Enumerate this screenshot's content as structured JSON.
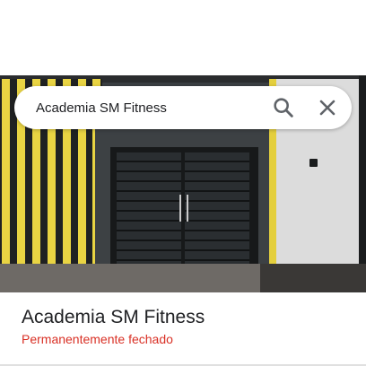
{
  "search": {
    "value": "Academia SM Fitness",
    "search_icon": "search-icon",
    "close_icon": "close-icon"
  },
  "photo": {
    "description_icon": "place-photo"
  },
  "place": {
    "name": "Academia SM Fitness",
    "status": "Permanentemente fechado"
  },
  "colors": {
    "status_red": "#d93025",
    "title_text": "#202124",
    "icon_gray": "#5f6368"
  }
}
